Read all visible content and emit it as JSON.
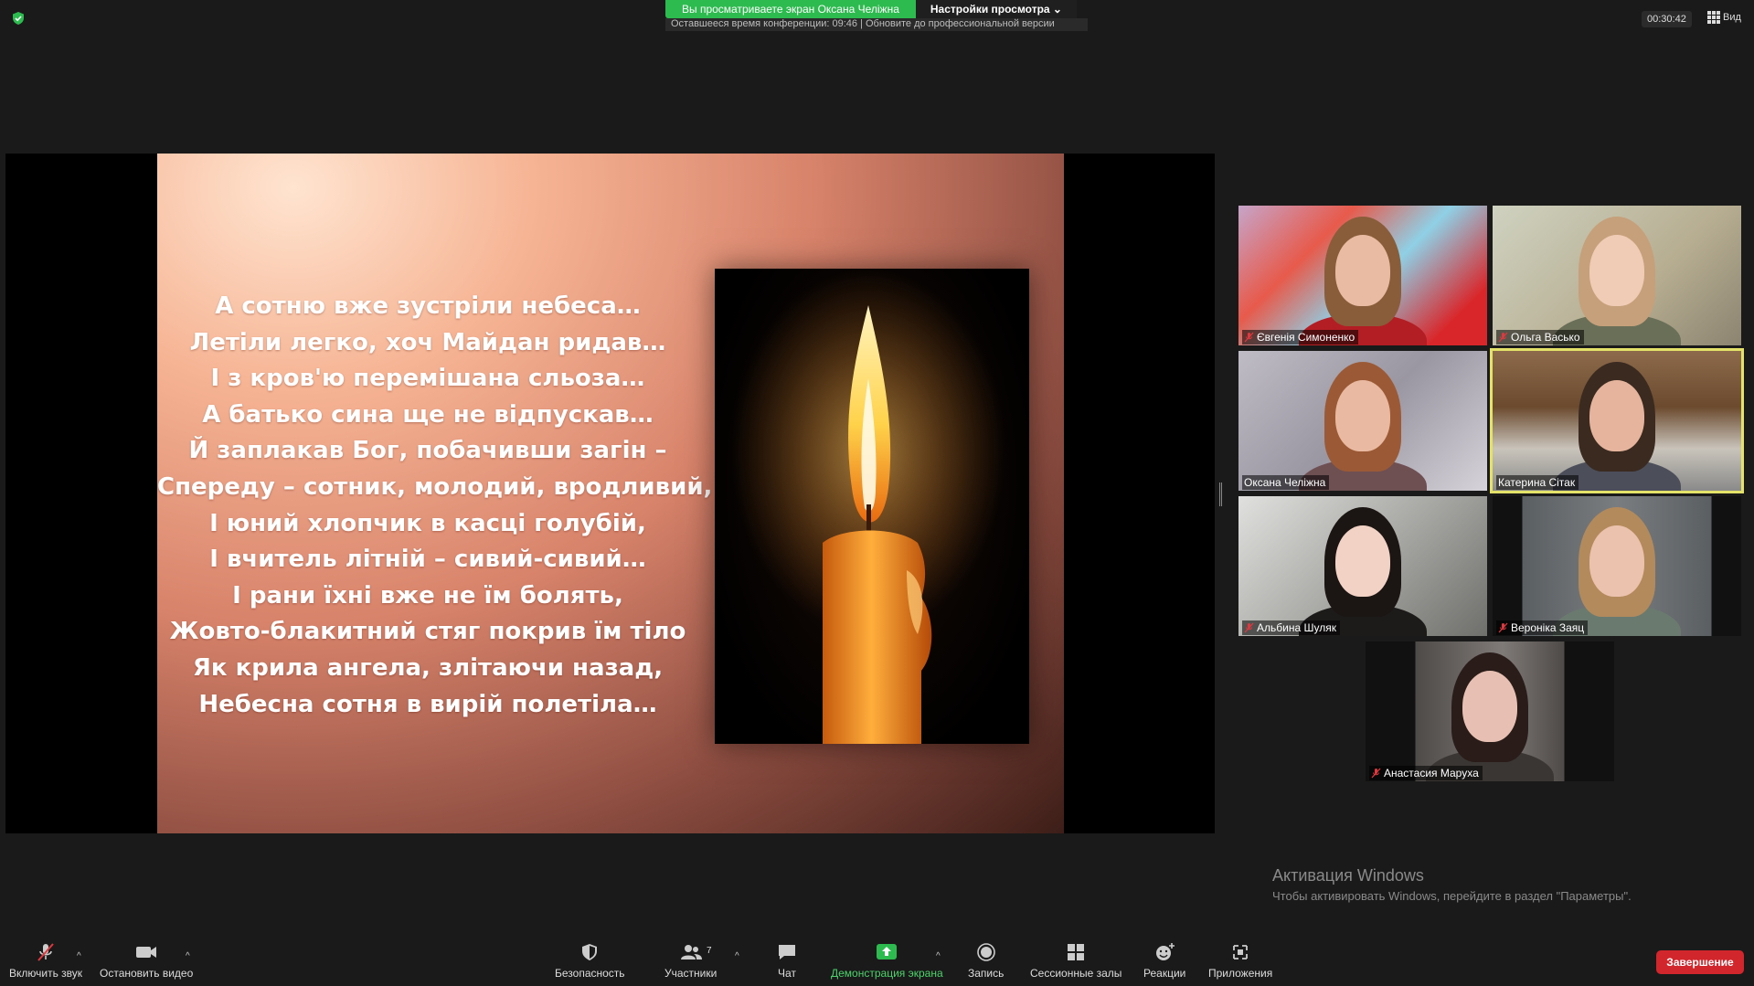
{
  "topbar": {
    "banner_text": "Вы просматриваете экран Оксана Челіжна",
    "view_settings_label": "Настройки просмотра ⌄",
    "remaining_time_text": "Оставшееся время конференции: 09:46 | Обновите до профессиональной версии",
    "timer": "00:30:42",
    "view_label": "Вид"
  },
  "slide": {
    "poem_lines": [
      "А сотню вже зустріли небеса…",
      "Летіли легко, хоч Майдан ридав…",
      "І з кров'ю перемішана сльоза…",
      "А батько сина ще не відпускав…",
      "Й заплакав Бог, побачивши загін –",
      "Спереду – сотник, молодий, вродливий,",
      "І юний хлопчик в касці голубій,",
      "І вчитель літній – сивий-сивий…",
      "І рани їхні вже не їм болять,",
      "Жовто-блакитний стяг покрив їм тіло",
      "Як крила ангела, злітаючи назад,",
      "Небесна сотня в вирій полетіла…"
    ]
  },
  "participants": [
    {
      "name": "Євгенія Симоненко",
      "muted": true
    },
    {
      "name": "Ольга Васько",
      "muted": true
    },
    {
      "name": "Оксана Челіжна",
      "muted": false
    },
    {
      "name": "Катерина Сітак",
      "muted": false,
      "active": true
    },
    {
      "name": "Альбина Шуляк",
      "muted": true
    },
    {
      "name": "Вероніка Заяц",
      "muted": true
    },
    {
      "name": "Анастасия Маруха",
      "muted": true
    }
  ],
  "watermark": {
    "title": "Активация Windows",
    "subtitle": "Чтобы активировать Windows, перейдите в раздел \"Параметры\"."
  },
  "toolbar": {
    "unmute": "Включить звук",
    "stop_video": "Остановить видео",
    "security": "Безопасность",
    "participants": "Участники",
    "participants_count": "7",
    "chat": "Чат",
    "share_screen": "Демонстрация экрана",
    "record": "Запись",
    "breakout": "Сессионные залы",
    "reactions": "Реакции",
    "apps": "Приложения",
    "end": "Завершение"
  },
  "colors": {
    "share_green": "#2dbb4f",
    "end_red": "#d0262c",
    "active_speaker": "#e5e26a"
  }
}
